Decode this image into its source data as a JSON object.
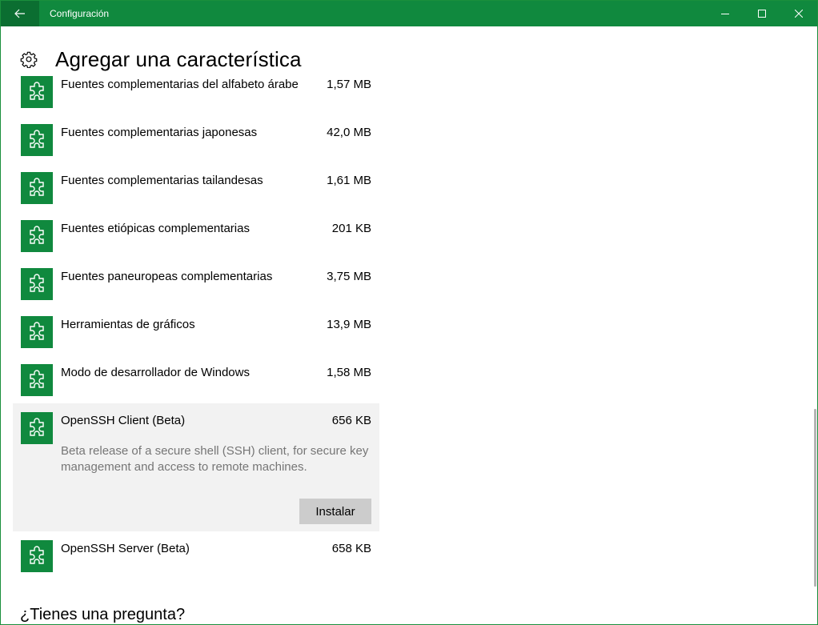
{
  "window": {
    "title": "Configuración",
    "accent": "#10893e"
  },
  "header": {
    "title": "Agregar una característica",
    "icon": "gear-icon"
  },
  "features": [
    {
      "name": "Fuentes complementarias del alfabeto árabe",
      "size": "1,57 MB"
    },
    {
      "name": "Fuentes complementarias japonesas",
      "size": "42,0 MB"
    },
    {
      "name": "Fuentes complementarias tailandesas",
      "size": "1,61 MB"
    },
    {
      "name": "Fuentes etiópicas complementarias",
      "size": "201 KB"
    },
    {
      "name": "Fuentes paneuropeas complementarias",
      "size": "3,75 MB"
    },
    {
      "name": "Herramientas de gráficos",
      "size": "13,9 MB"
    },
    {
      "name": "Modo de desarrollador de Windows",
      "size": "1,58 MB"
    },
    {
      "name": "OpenSSH Client (Beta)",
      "size": "656 KB",
      "description": "Beta release of a secure shell (SSH) client, for secure key management and access to remote machines.",
      "install_label": "Instalar"
    },
    {
      "name": "OpenSSH Server (Beta)",
      "size": "658 KB"
    }
  ],
  "footer": {
    "question": "¿Tienes una pregunta?"
  }
}
